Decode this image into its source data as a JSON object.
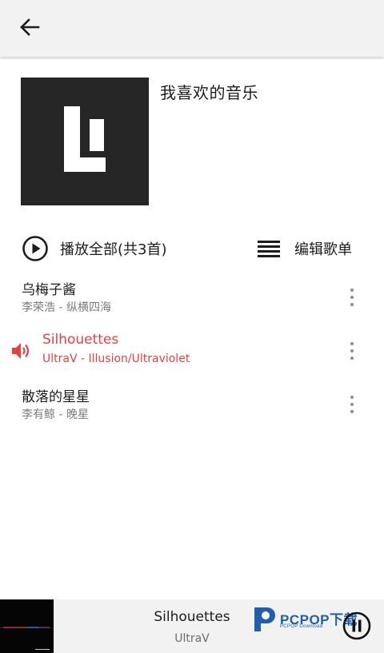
{
  "header": {
    "back_icon": "arrow-left-icon"
  },
  "playlist": {
    "title": "我喜欢的音乐",
    "cover_icon": "playlist-cover-logo"
  },
  "actions": {
    "play_all_label": "播放全部(共3首)",
    "play_all_icon": "play-circle-icon",
    "edit_label": "编辑歌单",
    "edit_icon": "list-icon"
  },
  "songs": [
    {
      "title": "乌梅子酱",
      "subtitle": "李荣浩 - 纵横四海",
      "playing": false
    },
    {
      "title": "Silhouettes",
      "subtitle": "UltraV - Illusion/Ultraviolet",
      "playing": true
    },
    {
      "title": "散落的星星",
      "subtitle": "李有鲸 - 晚星",
      "playing": false
    }
  ],
  "now_playing": {
    "title": "Silhouettes",
    "artist": "UltraV",
    "control_icon": "pause-icon"
  },
  "watermark": {
    "brand": "PCPOP下载",
    "sub": "PCPOP Download"
  },
  "colors": {
    "accent": "#e8403f",
    "bar_background": "#f2f2f2",
    "cover_background": "#262626",
    "watermark": "#1f5fae"
  }
}
